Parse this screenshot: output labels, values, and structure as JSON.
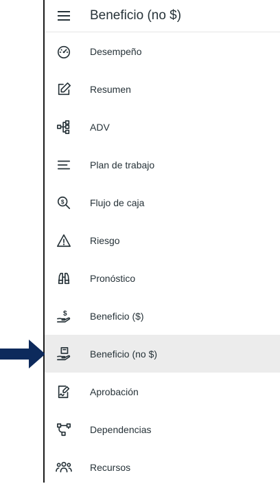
{
  "header": {
    "title": "Beneficio (no $)",
    "menu_icon": "hamburger-menu-icon"
  },
  "nav": {
    "items": [
      {
        "label": "Desempeño",
        "icon": "speedometer-icon"
      },
      {
        "label": "Resumen",
        "icon": "edit-icon"
      },
      {
        "label": "ADV",
        "icon": "hierarchy-icon"
      },
      {
        "label": "Plan de trabajo",
        "icon": "lines-icon"
      },
      {
        "label": "Flujo de caja",
        "icon": "dollar-search-icon"
      },
      {
        "label": "Riesgo",
        "icon": "warning-icon"
      },
      {
        "label": "Pronóstico",
        "icon": "binoculars-icon"
      },
      {
        "label": "Beneficio ($)",
        "icon": "hand-dollar-icon"
      },
      {
        "label": "Beneficio (no $)",
        "icon": "hand-box-icon",
        "active": true
      },
      {
        "label": "Aprobación",
        "icon": "signature-icon"
      },
      {
        "label": "Dependencias",
        "icon": "flow-icon"
      },
      {
        "label": "Recursos",
        "icon": "people-icon"
      }
    ]
  },
  "colors": {
    "arrow": "#0d2a5c",
    "active_bg": "#ececec",
    "text": "#263238"
  }
}
